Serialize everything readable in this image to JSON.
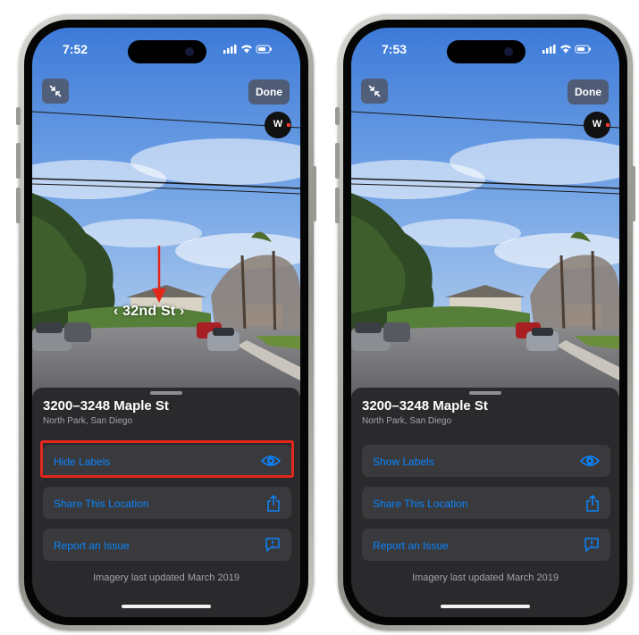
{
  "colors": {
    "accent": "#0a84ff",
    "annotation": "#e3271c",
    "sheet": "#2a2a2c",
    "row": "#3a3a3c"
  },
  "left_phone": {
    "status": {
      "time": "7:52"
    },
    "done_label": "Done",
    "compass_label": "W",
    "street_label": "‹ 32nd St ›",
    "sheet": {
      "address": "3200–3248 Maple St",
      "locality": "North Park, San Diego",
      "rows": [
        {
          "label": "Hide Labels",
          "icon": "eye-icon"
        },
        {
          "label": "Share This Location",
          "icon": "share-icon"
        },
        {
          "label": "Report an Issue",
          "icon": "report-issue-icon"
        }
      ],
      "footnote": "Imagery last updated March 2019"
    }
  },
  "right_phone": {
    "status": {
      "time": "7:53"
    },
    "done_label": "Done",
    "compass_label": "W",
    "sheet": {
      "address": "3200–3248 Maple St",
      "locality": "North Park, San Diego",
      "rows": [
        {
          "label": "Show Labels",
          "icon": "eye-icon"
        },
        {
          "label": "Share This Location",
          "icon": "share-icon"
        },
        {
          "label": "Report an Issue",
          "icon": "report-issue-icon"
        }
      ],
      "footnote": "Imagery last updated March 2019"
    }
  }
}
